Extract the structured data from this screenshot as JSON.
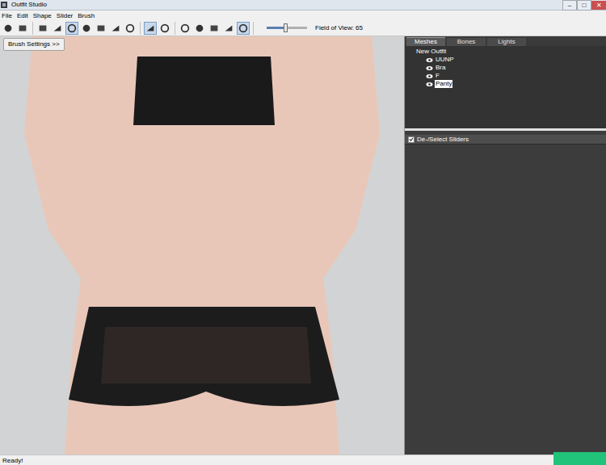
{
  "window": {
    "title": "Outfit Studio",
    "controls": [
      "–",
      "□",
      "✕"
    ]
  },
  "menu": [
    "File",
    "Edit",
    "Shape",
    "Slider",
    "Brush"
  ],
  "toolbar": {
    "groups": [
      [
        {
          "selected": false
        },
        {
          "selected": false
        }
      ],
      [
        {
          "selected": false
        },
        {
          "selected": false
        },
        {
          "selected": true
        },
        {
          "selected": false
        },
        {
          "selected": false
        },
        {
          "selected": false
        },
        {
          "selected": false
        }
      ],
      [
        {
          "selected": true
        },
        {
          "selected": false
        }
      ],
      [
        {
          "selected": false
        },
        {
          "selected": false
        },
        {
          "selected": false
        },
        {
          "selected": false
        },
        {
          "selected": true
        }
      ]
    ],
    "fov": {
      "level": 0.45,
      "label": "Field of View: 65"
    }
  },
  "viewport": {
    "brush_button": "Brush Settings >>"
  },
  "tabs": [
    {
      "label": "Meshes",
      "selected": true
    },
    {
      "label": "Bones",
      "selected": false
    },
    {
      "label": "Lights",
      "selected": false
    }
  ],
  "tree": {
    "root": "New Outfit",
    "items": [
      {
        "label": "UUNP",
        "visible": true,
        "selected": false
      },
      {
        "label": "Bra",
        "visible": true,
        "selected": false
      },
      {
        "label": "F",
        "visible": true,
        "selected": false
      },
      {
        "label": "Panty",
        "visible": true,
        "selected": true
      }
    ]
  },
  "sliders": {
    "label": "De-/Select Sliders",
    "checked": true
  },
  "status_bar": "Ready!"
}
